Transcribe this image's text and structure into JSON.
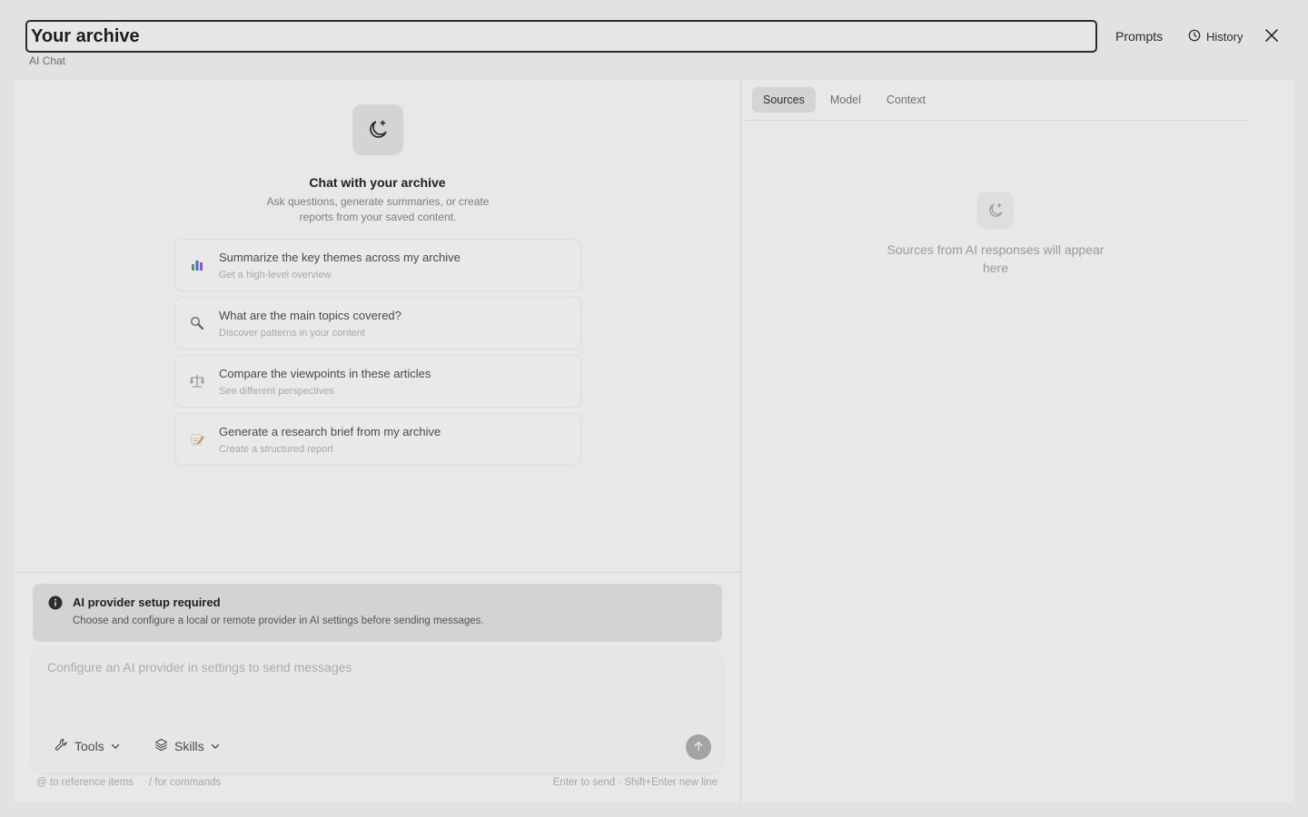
{
  "header": {
    "title_value": "Your archive",
    "subtitle": "AI Chat",
    "prompts_label": "Prompts",
    "history_label": "History"
  },
  "hero": {
    "icon": "moon-sparkle-icon",
    "title": "Chat with your archive",
    "description": "Ask questions, generate summaries, or create reports from your saved content."
  },
  "suggestions": [
    {
      "icon": "bar-chart-icon",
      "title": "Summarize the key themes across my archive",
      "subtitle": "Get a high-level overview"
    },
    {
      "icon": "magnifier-icon",
      "title": "What are the main topics covered?",
      "subtitle": "Discover patterns in your content"
    },
    {
      "icon": "balance-scale-icon",
      "title": "Compare the viewpoints in these articles",
      "subtitle": "See different perspectives"
    },
    {
      "icon": "memo-icon",
      "title": "Generate a research brief from my archive",
      "subtitle": "Create a structured report"
    }
  ],
  "notice": {
    "icon": "info-icon",
    "title": "AI provider setup required",
    "description": "Choose and configure a local or remote provider in AI settings before sending messages."
  },
  "composer": {
    "placeholder": "Configure an AI provider in settings to send messages",
    "value": "",
    "tools_label": "Tools",
    "skills_label": "Skills"
  },
  "hints": {
    "reference": "@ to reference items",
    "commands": "/ for commands",
    "send": "Enter to send · Shift+Enter new line"
  },
  "right_panel": {
    "tabs": [
      {
        "label": "Sources",
        "active": true
      },
      {
        "label": "Model",
        "active": false
      },
      {
        "label": "Context",
        "active": false
      }
    ],
    "empty_icon": "moon-sparkle-icon",
    "empty_text": "Sources from AI responses will appear here"
  },
  "colors": {
    "background": "#e2e2e2",
    "panel": "#e8e8e8",
    "notice_bg": "#d3d3d3",
    "send_button": "#a3a3a3",
    "chart_green": "#3aa55a",
    "chart_blue": "#3b6fd4",
    "chart_purple": "#8a5bd6"
  }
}
